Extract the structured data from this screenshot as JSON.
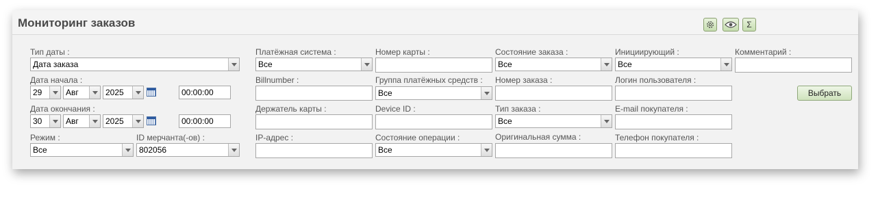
{
  "title": "Мониторинг заказов",
  "toolbar": {
    "settings_icon": "gear-icon",
    "view_icon": "eye-icon",
    "sum_icon": "sigma-icon",
    "sum_glyph": "Σ"
  },
  "fields": {
    "date_type": {
      "label": "Тип даты :",
      "value": "Дата заказа"
    },
    "date_start": {
      "label": "Дата начала :",
      "day": "29",
      "month": "Авг",
      "year": "2025",
      "time": "00:00:00"
    },
    "date_end": {
      "label": "Дата окончания :",
      "day": "30",
      "month": "Авг",
      "year": "2025",
      "time": "00:00:00"
    },
    "mode": {
      "label": "Режим :",
      "value": "Все"
    },
    "merchant_id": {
      "label": "ID мерчанта(-ов) :",
      "value": "802056"
    },
    "payment_system": {
      "label": "Платёжная система :",
      "value": "Все"
    },
    "billnumber": {
      "label": "Billnumber :",
      "value": ""
    },
    "card_holder": {
      "label": "Держатель карты :",
      "value": ""
    },
    "ip_address": {
      "label": "IP-адрес :",
      "value": ""
    },
    "card_number": {
      "label": "Номер карты :",
      "value": ""
    },
    "payment_group": {
      "label": "Группа платёжных средств :",
      "value": "Все"
    },
    "device_id": {
      "label": "Device ID :",
      "value": ""
    },
    "operation_state": {
      "label": "Состояние операции :",
      "value": "Все"
    },
    "order_state": {
      "label": "Состояние заказа :",
      "value": "Все"
    },
    "order_number": {
      "label": "Номер заказа :",
      "value": ""
    },
    "order_type": {
      "label": "Тип заказа :",
      "value": "Все"
    },
    "original_amount": {
      "label": "Оригинальная сумма :",
      "value": ""
    },
    "initiator": {
      "label": "Инициирующий :",
      "value": "Все"
    },
    "user_login": {
      "label": "Логин пользователя :",
      "value": ""
    },
    "buyer_email": {
      "label": "E-mail покупателя :",
      "value": ""
    },
    "buyer_phone": {
      "label": "Телефон покупателя :",
      "value": ""
    },
    "comment": {
      "label": "Комментарий :",
      "value": ""
    }
  },
  "actions": {
    "select_label": "Выбрать"
  }
}
